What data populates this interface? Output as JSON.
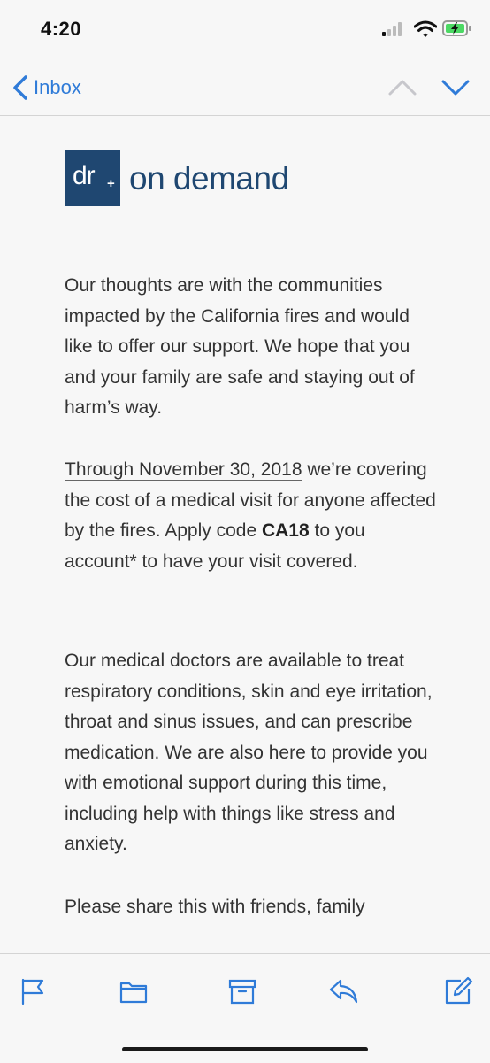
{
  "status_bar": {
    "time": "4:20",
    "icons": [
      "cellular-signal-icon",
      "wifi-icon",
      "battery-charging-icon"
    ]
  },
  "nav": {
    "back_label": "Inbox",
    "icons": [
      "chevron-left-icon",
      "chevron-up-icon",
      "chevron-down-icon"
    ],
    "accent_color": "#2f7bd8"
  },
  "email": {
    "logo": {
      "box_text": "dr",
      "box_plus": "+",
      "wordmark": "on demand",
      "brand_color": "#1f4771"
    },
    "p1": "Our thoughts are with the communities impacted by the California fires and would like to offer our support. We hope that you and your family are safe and staying out of harm’s way.",
    "p2": {
      "date": "Through November 30, 2018",
      "after_date": " we’re covering the cost of a medical visit for anyone affected by the fires. Apply code ",
      "code": "CA18",
      "end": " to you account* to have your visit covered."
    },
    "p3": "Our medical doctors are available to treat respiratory conditions, skin and eye irritation, throat and sinus issues, and can prescribe medication. We are also here to provide you with emotional support during this time, including help with things like stress and anxiety.",
    "p4": "Please share this with friends, family"
  },
  "toolbar": {
    "icons": [
      "flag-icon",
      "folder-icon",
      "archive-icon",
      "reply-icon",
      "compose-icon"
    ],
    "icon_color": "#2f7bd8"
  }
}
